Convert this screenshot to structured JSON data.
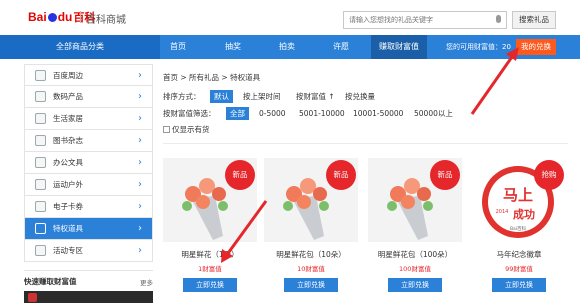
{
  "header": {
    "logo_text": "Bai",
    "logo_text2": "du",
    "logo_baike": "百科",
    "site_name": "百科商城",
    "search_placeholder": "请输入您想找的礼品关键字",
    "search_button": "搜索礼品"
  },
  "nav": {
    "category": "全部商品分类",
    "items": [
      "首页",
      "抽奖",
      "拍卖",
      "许愿",
      "赚取财富值"
    ],
    "points_label": "您的可用财富值：20",
    "exchange_button": "我的兑换"
  },
  "sidebar": {
    "items": [
      {
        "label": "百度周边"
      },
      {
        "label": "数码产品"
      },
      {
        "label": "生活家居"
      },
      {
        "label": "图书杂志"
      },
      {
        "label": "办公文具"
      },
      {
        "label": "运动户外"
      },
      {
        "label": "电子卡券"
      },
      {
        "label": "特权道具"
      },
      {
        "label": "活动专区"
      }
    ],
    "active_index": 7,
    "quick_title": "快速赚取财富值",
    "quick_more": "更多"
  },
  "breadcrumb": "首页 > 所有礼品 > 特权道具",
  "sort": {
    "label": "排序方式：",
    "options": [
      "默认",
      "按上架时间",
      "按财富值 ↑",
      "按兑换量"
    ]
  },
  "filter": {
    "label": "按财富值筛选：",
    "options": [
      "全部",
      "0-5000",
      "5001-10000",
      "10001-50000",
      "50000以上"
    ]
  },
  "in_stock_label": "仅显示有货",
  "products": [
    {
      "badge": "新品",
      "name": "明星鲜花（1朵）",
      "price": "1财富值",
      "button": "立即兑换"
    },
    {
      "badge": "新品",
      "name": "明星鲜花包（10朵）",
      "price": "10财富值",
      "button": "立即兑换"
    },
    {
      "badge": "新品",
      "name": "明星鲜花包（100朵）",
      "price": "100财富值",
      "button": "立即兑换"
    },
    {
      "badge": "抢购",
      "name": "马年纪念徽章",
      "price": "99财富值",
      "button": "立即兑换"
    }
  ],
  "badge_art": {
    "main": "马上",
    "sub": "成功",
    "year": "2014",
    "brand": "Bai百科"
  },
  "colors": {
    "brand_blue": "#2b80d8",
    "accent_red": "#e5262b",
    "orange": "#ff5a1e"
  }
}
